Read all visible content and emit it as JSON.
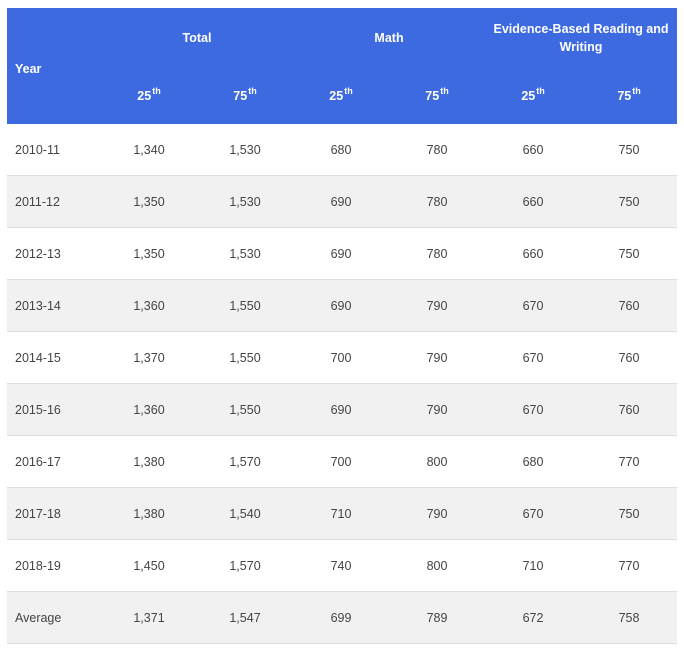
{
  "header": {
    "year_label": "Year",
    "groups": [
      "Total",
      "Math",
      "Evidence-Based Reading and Writing"
    ],
    "percentile_base": "25",
    "percentile_suffix": "th",
    "percentiles": [
      {
        "num": "25",
        "sup": "th"
      },
      {
        "num": "75",
        "sup": "th"
      },
      {
        "num": "25",
        "sup": "th"
      },
      {
        "num": "75",
        "sup": "th"
      },
      {
        "num": "25",
        "sup": "th"
      },
      {
        "num": "75",
        "sup": "th"
      }
    ]
  },
  "rows": [
    {
      "year": "2010-11",
      "cells": [
        "1,340",
        "1,530",
        "680",
        "780",
        "660",
        "750"
      ]
    },
    {
      "year": "2011-12",
      "cells": [
        "1,350",
        "1,530",
        "690",
        "780",
        "660",
        "750"
      ]
    },
    {
      "year": "2012-13",
      "cells": [
        "1,350",
        "1,530",
        "690",
        "780",
        "660",
        "750"
      ]
    },
    {
      "year": "2013-14",
      "cells": [
        "1,360",
        "1,550",
        "690",
        "790",
        "670",
        "760"
      ]
    },
    {
      "year": "2014-15",
      "cells": [
        "1,370",
        "1,550",
        "700",
        "790",
        "670",
        "760"
      ]
    },
    {
      "year": "2015-16",
      "cells": [
        "1,360",
        "1,550",
        "690",
        "790",
        "670",
        "760"
      ]
    },
    {
      "year": "2016-17",
      "cells": [
        "1,380",
        "1,570",
        "700",
        "800",
        "680",
        "770"
      ]
    },
    {
      "year": "2017-18",
      "cells": [
        "1,380",
        "1,540",
        "710",
        "790",
        "670",
        "750"
      ]
    },
    {
      "year": "2018-19",
      "cells": [
        "1,450",
        "1,570",
        "740",
        "800",
        "710",
        "770"
      ]
    },
    {
      "year": "Average",
      "cells": [
        "1,371",
        "1,547",
        "699",
        "789",
        "672",
        "758"
      ]
    }
  ],
  "colors": {
    "header_bg": "#3e6ae1",
    "header_text": "#ffffff",
    "row_alt_bg": "#f1f1f1",
    "row_border": "#dedede",
    "body_text": "#444444"
  }
}
